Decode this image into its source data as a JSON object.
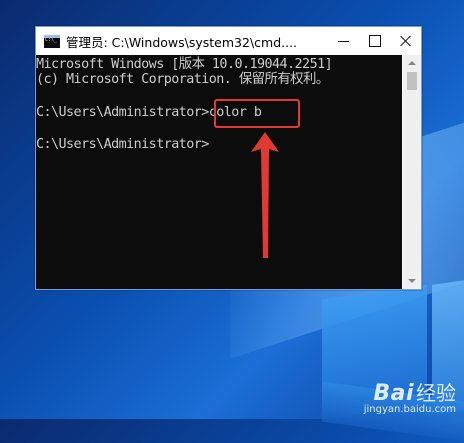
{
  "window": {
    "title": "管理员: C:\\Windows\\system32\\cmd....",
    "app_icon": "cmd-icon"
  },
  "console": {
    "lines": [
      "Microsoft Windows [版本 10.0.19044.2251]",
      "(c) Microsoft Corporation. 保留所有权利。",
      "C:\\Users\\Administrator>color b",
      "C:\\Users\\Administrator>"
    ]
  },
  "annotation": {
    "color": "#e23a32"
  },
  "watermark": {
    "logo": "Bai",
    "logo_suffix": "经验",
    "url": "jingyan.baidu.com"
  }
}
